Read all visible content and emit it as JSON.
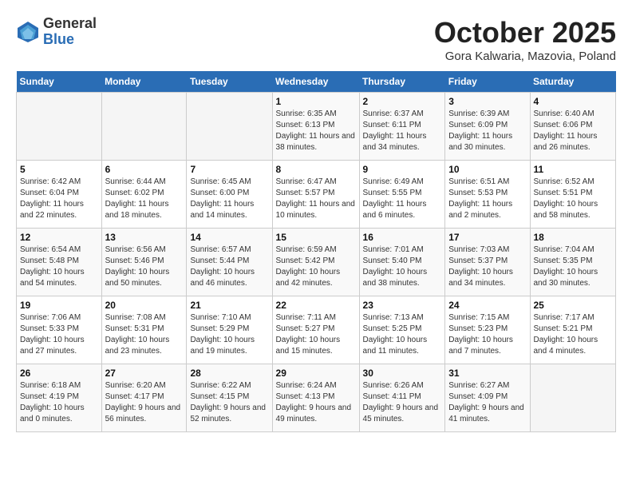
{
  "logo": {
    "general": "General",
    "blue": "Blue"
  },
  "title": "October 2025",
  "subtitle": "Gora Kalwaria, Mazovia, Poland",
  "weekdays": [
    "Sunday",
    "Monday",
    "Tuesday",
    "Wednesday",
    "Thursday",
    "Friday",
    "Saturday"
  ],
  "weeks": [
    [
      {
        "day": "",
        "sunrise": "",
        "sunset": "",
        "daylight": ""
      },
      {
        "day": "",
        "sunrise": "",
        "sunset": "",
        "daylight": ""
      },
      {
        "day": "",
        "sunrise": "",
        "sunset": "",
        "daylight": ""
      },
      {
        "day": "1",
        "sunrise": "Sunrise: 6:35 AM",
        "sunset": "Sunset: 6:13 PM",
        "daylight": "Daylight: 11 hours and 38 minutes."
      },
      {
        "day": "2",
        "sunrise": "Sunrise: 6:37 AM",
        "sunset": "Sunset: 6:11 PM",
        "daylight": "Daylight: 11 hours and 34 minutes."
      },
      {
        "day": "3",
        "sunrise": "Sunrise: 6:39 AM",
        "sunset": "Sunset: 6:09 PM",
        "daylight": "Daylight: 11 hours and 30 minutes."
      },
      {
        "day": "4",
        "sunrise": "Sunrise: 6:40 AM",
        "sunset": "Sunset: 6:06 PM",
        "daylight": "Daylight: 11 hours and 26 minutes."
      }
    ],
    [
      {
        "day": "5",
        "sunrise": "Sunrise: 6:42 AM",
        "sunset": "Sunset: 6:04 PM",
        "daylight": "Daylight: 11 hours and 22 minutes."
      },
      {
        "day": "6",
        "sunrise": "Sunrise: 6:44 AM",
        "sunset": "Sunset: 6:02 PM",
        "daylight": "Daylight: 11 hours and 18 minutes."
      },
      {
        "day": "7",
        "sunrise": "Sunrise: 6:45 AM",
        "sunset": "Sunset: 6:00 PM",
        "daylight": "Daylight: 11 hours and 14 minutes."
      },
      {
        "day": "8",
        "sunrise": "Sunrise: 6:47 AM",
        "sunset": "Sunset: 5:57 PM",
        "daylight": "Daylight: 11 hours and 10 minutes."
      },
      {
        "day": "9",
        "sunrise": "Sunrise: 6:49 AM",
        "sunset": "Sunset: 5:55 PM",
        "daylight": "Daylight: 11 hours and 6 minutes."
      },
      {
        "day": "10",
        "sunrise": "Sunrise: 6:51 AM",
        "sunset": "Sunset: 5:53 PM",
        "daylight": "Daylight: 11 hours and 2 minutes."
      },
      {
        "day": "11",
        "sunrise": "Sunrise: 6:52 AM",
        "sunset": "Sunset: 5:51 PM",
        "daylight": "Daylight: 10 hours and 58 minutes."
      }
    ],
    [
      {
        "day": "12",
        "sunrise": "Sunrise: 6:54 AM",
        "sunset": "Sunset: 5:48 PM",
        "daylight": "Daylight: 10 hours and 54 minutes."
      },
      {
        "day": "13",
        "sunrise": "Sunrise: 6:56 AM",
        "sunset": "Sunset: 5:46 PM",
        "daylight": "Daylight: 10 hours and 50 minutes."
      },
      {
        "day": "14",
        "sunrise": "Sunrise: 6:57 AM",
        "sunset": "Sunset: 5:44 PM",
        "daylight": "Daylight: 10 hours and 46 minutes."
      },
      {
        "day": "15",
        "sunrise": "Sunrise: 6:59 AM",
        "sunset": "Sunset: 5:42 PM",
        "daylight": "Daylight: 10 hours and 42 minutes."
      },
      {
        "day": "16",
        "sunrise": "Sunrise: 7:01 AM",
        "sunset": "Sunset: 5:40 PM",
        "daylight": "Daylight: 10 hours and 38 minutes."
      },
      {
        "day": "17",
        "sunrise": "Sunrise: 7:03 AM",
        "sunset": "Sunset: 5:37 PM",
        "daylight": "Daylight: 10 hours and 34 minutes."
      },
      {
        "day": "18",
        "sunrise": "Sunrise: 7:04 AM",
        "sunset": "Sunset: 5:35 PM",
        "daylight": "Daylight: 10 hours and 30 minutes."
      }
    ],
    [
      {
        "day": "19",
        "sunrise": "Sunrise: 7:06 AM",
        "sunset": "Sunset: 5:33 PM",
        "daylight": "Daylight: 10 hours and 27 minutes."
      },
      {
        "day": "20",
        "sunrise": "Sunrise: 7:08 AM",
        "sunset": "Sunset: 5:31 PM",
        "daylight": "Daylight: 10 hours and 23 minutes."
      },
      {
        "day": "21",
        "sunrise": "Sunrise: 7:10 AM",
        "sunset": "Sunset: 5:29 PM",
        "daylight": "Daylight: 10 hours and 19 minutes."
      },
      {
        "day": "22",
        "sunrise": "Sunrise: 7:11 AM",
        "sunset": "Sunset: 5:27 PM",
        "daylight": "Daylight: 10 hours and 15 minutes."
      },
      {
        "day": "23",
        "sunrise": "Sunrise: 7:13 AM",
        "sunset": "Sunset: 5:25 PM",
        "daylight": "Daylight: 10 hours and 11 minutes."
      },
      {
        "day": "24",
        "sunrise": "Sunrise: 7:15 AM",
        "sunset": "Sunset: 5:23 PM",
        "daylight": "Daylight: 10 hours and 7 minutes."
      },
      {
        "day": "25",
        "sunrise": "Sunrise: 7:17 AM",
        "sunset": "Sunset: 5:21 PM",
        "daylight": "Daylight: 10 hours and 4 minutes."
      }
    ],
    [
      {
        "day": "26",
        "sunrise": "Sunrise: 6:18 AM",
        "sunset": "Sunset: 4:19 PM",
        "daylight": "Daylight: 10 hours and 0 minutes."
      },
      {
        "day": "27",
        "sunrise": "Sunrise: 6:20 AM",
        "sunset": "Sunset: 4:17 PM",
        "daylight": "Daylight: 9 hours and 56 minutes."
      },
      {
        "day": "28",
        "sunrise": "Sunrise: 6:22 AM",
        "sunset": "Sunset: 4:15 PM",
        "daylight": "Daylight: 9 hours and 52 minutes."
      },
      {
        "day": "29",
        "sunrise": "Sunrise: 6:24 AM",
        "sunset": "Sunset: 4:13 PM",
        "daylight": "Daylight: 9 hours and 49 minutes."
      },
      {
        "day": "30",
        "sunrise": "Sunrise: 6:26 AM",
        "sunset": "Sunset: 4:11 PM",
        "daylight": "Daylight: 9 hours and 45 minutes."
      },
      {
        "day": "31",
        "sunrise": "Sunrise: 6:27 AM",
        "sunset": "Sunset: 4:09 PM",
        "daylight": "Daylight: 9 hours and 41 minutes."
      },
      {
        "day": "",
        "sunrise": "",
        "sunset": "",
        "daylight": ""
      }
    ]
  ]
}
